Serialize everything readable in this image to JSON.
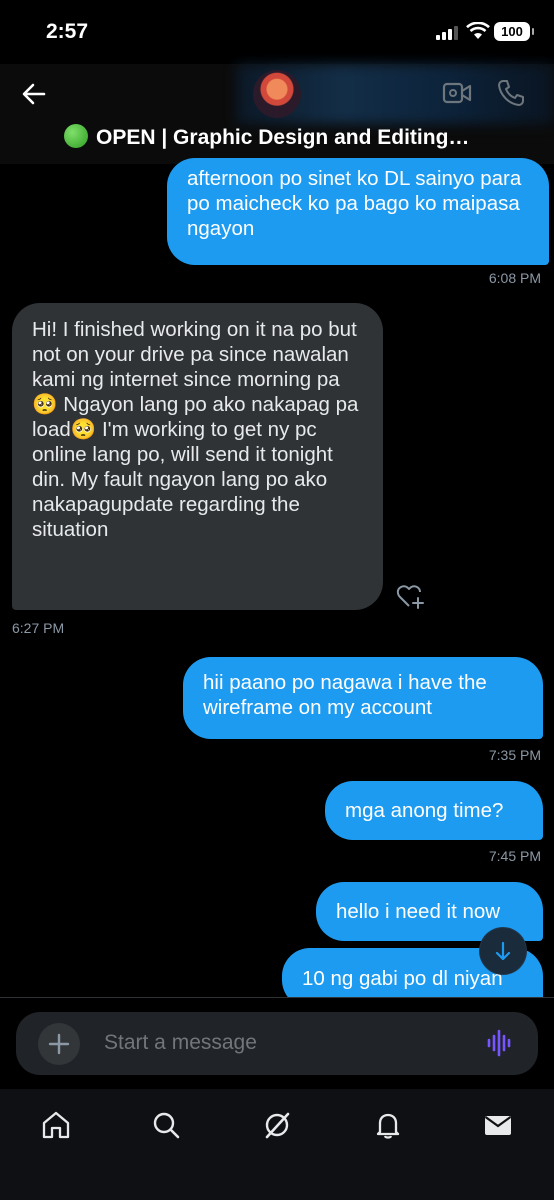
{
  "status_bar": {
    "time": "2:57",
    "battery": "100"
  },
  "header": {
    "title": "OPEN | Graphic Design and Editing…"
  },
  "messages": [
    {
      "text": "afternoon po sinet ko DL sainyo para po maicheck ko pa bago ko maipasa ngayon",
      "time": "6:08 PM"
    },
    {
      "text": "Hi! I finished working on it na po but not on your drive pa since nawalan kami ng internet since morning pa🥺 Ngayon lang po ako nakapag pa load🥺 I'm working to get ny pc online lang po, will send it tonight din. My fault ngayon lang po ako nakapagupdate regarding the situation",
      "time": "6:27 PM"
    },
    {
      "text": "hii paano po nagawa i have the wireframe on my account",
      "time": "7:35 PM"
    },
    {
      "text": "mga anong time?",
      "time": "7:45 PM"
    },
    {
      "text": "hello i need it now"
    },
    {
      "text": "10 ng gabi po dl niyan"
    }
  ],
  "composer": {
    "placeholder": "Start a message"
  },
  "colors": {
    "outgoing": "#1d9bf0",
    "incoming": "#2f3336",
    "background": "#000000",
    "voice_accent": "#7856ff"
  },
  "icons": [
    "back-arrow-icon",
    "video-call-icon",
    "phone-call-icon",
    "add-reaction-icon",
    "scroll-down-icon",
    "plus-icon",
    "voice-message-icon",
    "home-icon",
    "search-icon",
    "grok-icon",
    "notifications-icon",
    "messages-icon"
  ]
}
